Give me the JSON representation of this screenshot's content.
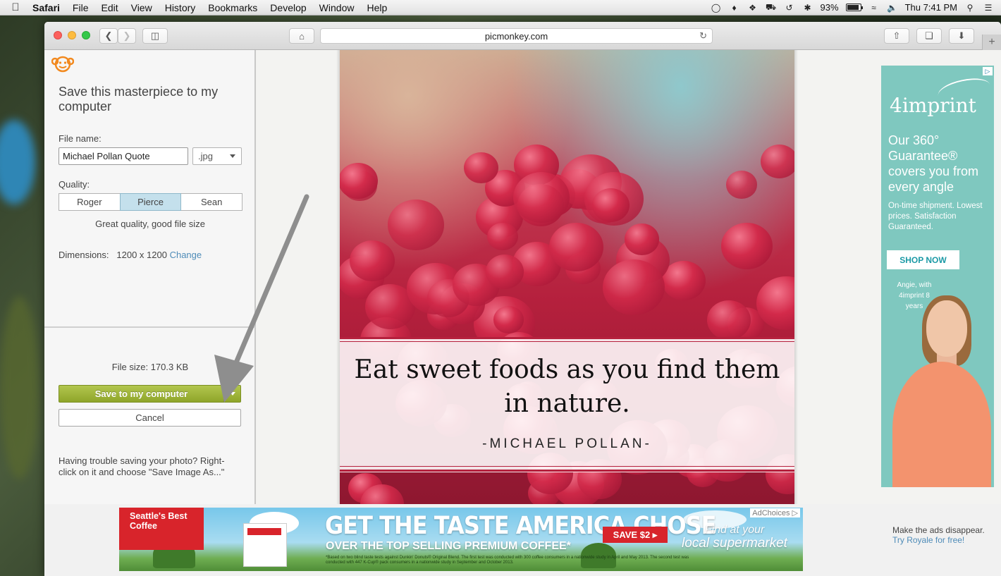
{
  "menubar": {
    "app_name": "Safari",
    "items": [
      "File",
      "Edit",
      "View",
      "History",
      "Bookmarks",
      "Develop",
      "Window",
      "Help"
    ],
    "battery": "93%",
    "clock": "Thu 7:41 PM"
  },
  "browser": {
    "url": "picmonkey.com"
  },
  "save_panel": {
    "title": "Save this masterpiece to my computer",
    "file_name_label": "File name:",
    "file_name_value": "Michael Pollan Quote",
    "extension": ".jpg",
    "quality_label": "Quality:",
    "quality_options": [
      "Roger",
      "Pierce",
      "Sean"
    ],
    "quality_selected": "Pierce",
    "quality_description": "Great quality, good file size",
    "dimensions_label": "Dimensions:",
    "dimensions_value": "1200 x 1200",
    "change_link": "Change",
    "file_size": "File size: 170.3 KB",
    "save_button": "Save to my computer",
    "cancel_button": "Cancel",
    "help_text": "Having trouble saving your photo? Right-click on it and choose \"Save Image As...\""
  },
  "canvas": {
    "quote": "Eat sweet foods as you find them in nature.",
    "author": "-MICHAEL POLLAN-"
  },
  "side_ad": {
    "brand": "4imprint",
    "headline": "Our 360° Guarantee® covers you from every angle",
    "subtext": "On-time shipment. Lowest prices. Satisfaction Guaranteed.",
    "cta": "SHOP NOW",
    "caption": "Angie, with 4imprint 8 years"
  },
  "banner_ad": {
    "brand": "Seattle's Best Coffee",
    "headline": "GET THE TASTE AMERICA CHOSE",
    "subline": "OVER THE TOP SELLING PREMIUM COFFEE*",
    "save": "SAVE $2",
    "find_line1": "Find at your",
    "find_line2": "local supermarket",
    "adchoices": "AdChoices",
    "fine_print": "*Based on two blind taste tests against Dunkin' Donuts® Original Blend. The first test was conducted with 300 coffee consumers in a nationwide study in April and May 2013. The second test was conducted with 447 K-Cup® pack consumers in a nationwide study in September and October 2013."
  },
  "royale": {
    "text": "Make the ads disappear.",
    "link": "Try Royale for free!"
  },
  "colors": {
    "save_green": "#9cb23a",
    "selected_quality": "#c4e0ec",
    "link_blue": "#4f8cb8",
    "ad_teal": "#7fc8bf"
  }
}
